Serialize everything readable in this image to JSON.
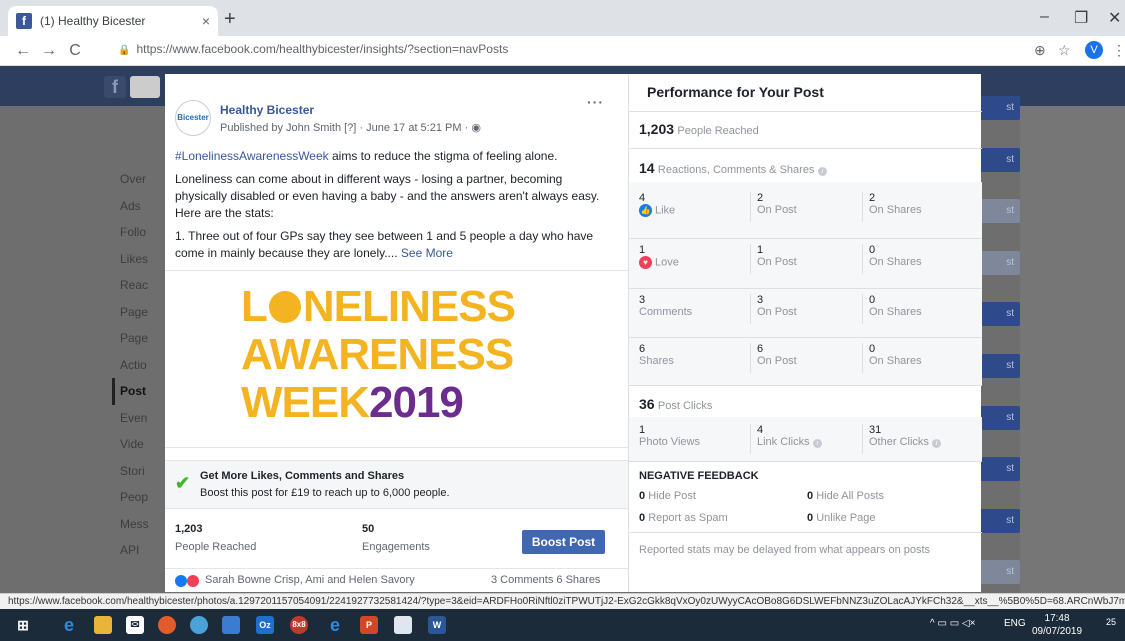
{
  "browser": {
    "tab_title": "(1) Healthy Bicester",
    "tab_close": "×",
    "new_tab": "+",
    "url": "https://www.facebook.com/healthybicester/insights/?section=navPosts",
    "profile_initial": "V",
    "status_url": "https://www.facebook.com/healthybicester/photos/a.1297201157054091/2241927732581424/?type=3&eid=ARDFHo0RiNftl0ziTPWUTjJ2-ExG2cGkk8qVxOy0zUWyyCAcOBo8G6DSLWEFbNNZ3uZOLacAJYkFCh32&__xts__%5B0%5D=68.ARCnWbJ7milZvU..."
  },
  "fb_bg": {
    "logo": "f",
    "sidenav": [
      "Over",
      "Ads",
      "Follo",
      "Likes",
      "Reac",
      "Page",
      "Page",
      "Actio",
      "Post",
      "Even",
      "Vide",
      "Stori",
      "Peop",
      "Mess",
      "API"
    ],
    "active_index": 8,
    "right_btn_text": "st"
  },
  "post": {
    "page_name": "Healthy Bicester",
    "avatar_text": "Bicester",
    "published": "Published by John Smith [?] · June 17 at 5:21 PM · ",
    "menu": "···",
    "hashtag": "#LonelinessAwarenessWeek",
    "line1_rest": " aims to reduce the stigma of feeling alone.",
    "para2": "Loneliness can come about in different ways - losing a partner, becoming physically disabled or even having a baby - and the answers aren't always easy. Here are the stats:",
    "para3": "1. Three out of four GPs say they see between 1 and 5 people a day who have come in mainly because they are lonely.... ",
    "see_more": "See More",
    "image_line1_L": "L",
    "image_line1_rest": "NELINESS",
    "image_line2": "AWARENESS",
    "image_line3_a": "WEEK",
    "image_line3_b": "2019",
    "boost_title": "Get More Likes, Comments and Shares",
    "boost_sub": "Boost this post for £19 to reach up to 6,000 people.",
    "reached_value": "1,203",
    "reached_label": "People Reached",
    "engagements_value": "50",
    "engagements_label": "Engagements",
    "boost_button": "Boost Post",
    "reaction_names": "Sarah Bowne Crisp, Ami and Helen Savory",
    "reaction_counts": "3 Comments  6 Shares"
  },
  "performance": {
    "title": "Performance for Your Post",
    "reached_value": "1,203",
    "reached_label": "People Reached",
    "rcs_value": "14",
    "rcs_label": "Reactions, Comments & Shares",
    "rows": [
      {
        "total": "4",
        "type": "Like",
        "on_post": "2",
        "on_post_label": "On Post",
        "on_shares": "2",
        "on_shares_label": "On Shares"
      },
      {
        "total": "1",
        "type": "Love",
        "on_post": "1",
        "on_post_label": "On Post",
        "on_shares": "0",
        "on_shares_label": "On Shares"
      },
      {
        "total": "3",
        "type": "Comments",
        "on_post": "3",
        "on_post_label": "On Post",
        "on_shares": "0",
        "on_shares_label": "On Shares"
      },
      {
        "total": "6",
        "type": "Shares",
        "on_post": "6",
        "on_post_label": "On Post",
        "on_shares": "0",
        "on_shares_label": "On Shares"
      }
    ],
    "clicks_value": "36",
    "clicks_label": "Post Clicks",
    "photo_views": "1",
    "photo_views_label": "Photo Views",
    "link_clicks": "4",
    "link_clicks_label": "Link Clicks",
    "other_clicks": "31",
    "other_clicks_label": "Other Clicks",
    "negative_title": "NEGATIVE FEEDBACK",
    "hide_post_n": "0",
    "hide_post": "Hide Post",
    "hide_all_n": "0",
    "hide_all": "Hide All Posts",
    "spam_n": "0",
    "spam": "Report as Spam",
    "unlike_n": "0",
    "unlike": "Unlike Page",
    "note": "Reported stats may be delayed from what appears on posts"
  },
  "taskbar": {
    "lang": "ENG",
    "time": "17:48",
    "date": "09/07/2019",
    "notif": "25"
  }
}
